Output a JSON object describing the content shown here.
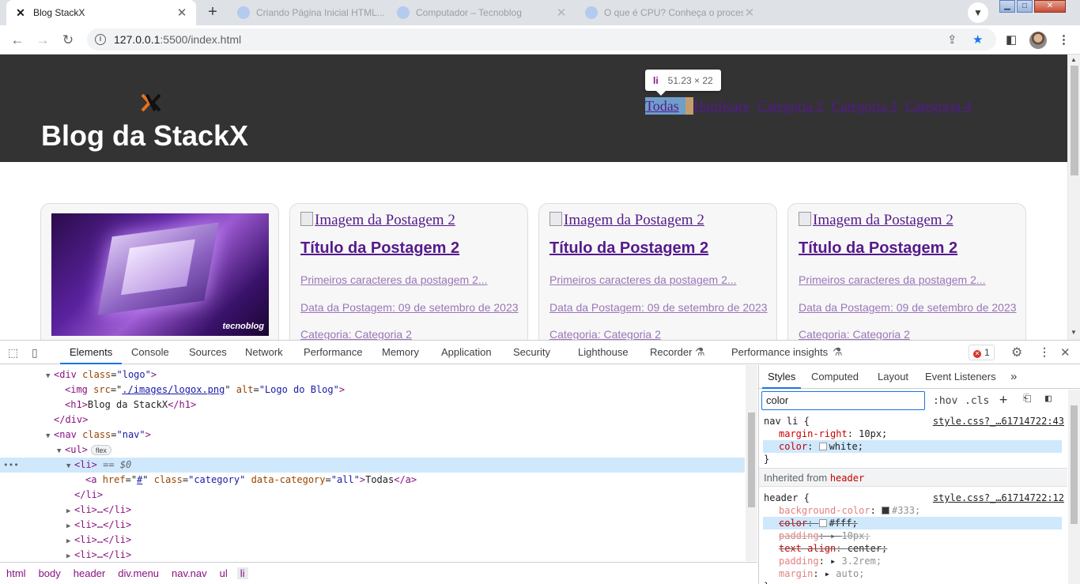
{
  "browser": {
    "tabs": [
      {
        "title": "Blog StackX",
        "active": true,
        "favicon": "stackx-x-icon"
      },
      {
        "title": "Criando Página Inicial HTML...",
        "active": false,
        "favicon": "globe-icon"
      },
      {
        "title": "Computador – Tecnoblog",
        "active": false,
        "favicon": "globe-icon"
      },
      {
        "title": "O que é CPU? Conheça o proces...",
        "active": false,
        "favicon": "globe-icon"
      }
    ],
    "new_tab": "+",
    "address": {
      "host": "127.0.0.1",
      "path": ":5500/index.html"
    }
  },
  "page": {
    "site_title": "Blog da StackX",
    "nav": [
      {
        "label": "Todas",
        "highlighted": true
      },
      {
        "label": "Hardware"
      },
      {
        "label": "Categoria 2"
      },
      {
        "label": "Categoria 3"
      },
      {
        "label": "Categoria 4"
      }
    ],
    "tooltip": {
      "tag": "li",
      "size": "51.23 × 22"
    },
    "cards": [
      {
        "has_image": true,
        "image_brand": "tecnoblog"
      },
      {
        "broken_alt": "Imagem da Postagem 2",
        "title": "Título da Postagem 2",
        "excerpt": "Primeiros caracteres da postagem 2...",
        "date": "Data da Postagem: 09 de setembro de 2023",
        "category": "Categoria: Categoria 2"
      },
      {
        "broken_alt": "Imagem da Postagem 2",
        "title": "Título da Postagem 2",
        "excerpt": "Primeiros caracteres da postagem 2...",
        "date": "Data da Postagem: 09 de setembro de 2023",
        "category": "Categoria: Categoria 2"
      },
      {
        "broken_alt": "Imagem da Postagem 2",
        "title": "Título da Postagem 2",
        "excerpt": "Primeiros caracteres da postagem 2...",
        "date": "Data da Postagem: 09 de setembro de 2023",
        "category": "Categoria: Categoria 2"
      }
    ]
  },
  "devtools": {
    "tabs": [
      "Elements",
      "Console",
      "Sources",
      "Network",
      "Performance",
      "Memory",
      "Application",
      "Security",
      "Lighthouse",
      "Recorder",
      "Performance insights"
    ],
    "active_tab": "Elements",
    "error_count": "1",
    "dom": {
      "l1": {
        "tag": "<div",
        "attr": "class",
        "val": "\"logo\"",
        "close": ">"
      },
      "l2": {
        "tag": "<img",
        "attr1": "src",
        "val1": "./images/logox.png",
        "attr2": "alt",
        "val2": "\"Logo do Blog\"",
        "close": ">"
      },
      "l3": {
        "open": "<h1>",
        "text": "Blog da StackX",
        "close": "</h1>"
      },
      "l4": {
        "close": "</div>"
      },
      "l5": {
        "tag": "<nav",
        "attr": "class",
        "val": "\"nav\"",
        "close": ">"
      },
      "l6": {
        "open": "<ul>",
        "pill": "flex"
      },
      "l7": {
        "open": "<li>",
        "eq": "== $0"
      },
      "l8": {
        "tag": "<a",
        "attr1": "href",
        "val1": "#",
        "attr2": "class",
        "val2": "\"category\"",
        "attr3": "data-category",
        "val3": "\"all\"",
        "text": "Todas",
        "close": "</a>"
      },
      "l9": {
        "close": "</li>"
      },
      "collapsed": "<li>…</li>"
    },
    "breadcrumbs": [
      "html",
      "body",
      "header",
      "div.menu",
      "nav.nav",
      "ul",
      "li"
    ],
    "side_tabs": [
      "Styles",
      "Computed",
      "Layout",
      "Event Listeners"
    ],
    "filter_value": "color",
    "filter_tools": {
      "hov": ":hov",
      "cls": ".cls"
    },
    "rules": {
      "r1_selector": "nav li {",
      "r1_source": "style.css?_…61714722:43",
      "r1_p1_name": "margin-right",
      "r1_p1_value": "10px;",
      "r1_p2_name": "color",
      "r1_p2_value": "white;",
      "inherited_label": "Inherited from",
      "inherited_from": "header",
      "r2_selector": "header {",
      "r2_source": "style.css?_…61714722:12",
      "r2_p1_name": "background-color",
      "r2_p1_value": "#333;",
      "r2_p2_name": "color",
      "r2_p2_value": "#fff;",
      "r2_p3_name": "padding",
      "r2_p3_value": "10px;",
      "r2_p4_name": "text-align",
      "r2_p4_value": "center;",
      "r2_p5_name": "padding",
      "r2_p5_value": "3.2rem;",
      "r2_p6_name": "margin",
      "r2_p6_value": "auto;",
      "close": "}"
    }
  },
  "colors": {
    "site_header": "#333333",
    "accent_blue": "#1a73e8",
    "tag_purple": "#881280",
    "link_purple": "#551a8b"
  }
}
